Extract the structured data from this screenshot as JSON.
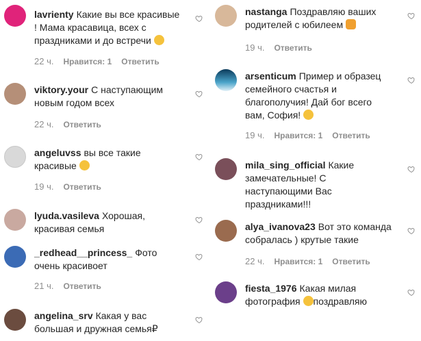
{
  "left": [
    {
      "user": "lavrienty",
      "text": "Какие вы все красивые ! Мама красавица, всех с праздниками и до встречи",
      "emoji": "😘",
      "time": "22 ч.",
      "likes": "Нравится: 1",
      "reply": "Ответить",
      "avatar": "#e0237a"
    },
    {
      "user": "viktory.your",
      "text": "С наступающим новым годом всех",
      "emoji": "",
      "time": "22 ч.",
      "likes": "",
      "reply": "Ответить",
      "avatar": "#b58f78"
    },
    {
      "user": "angeluvss",
      "text": "вы все такие красивые",
      "emoji": "😍",
      "time": "19 ч.",
      "likes": "",
      "reply": "Ответить",
      "avatar": "#d9d9d9"
    },
    {
      "user": "lyuda.vasileva",
      "text": "Хорошая, красивая семья",
      "emoji": "",
      "time": "",
      "likes": "",
      "reply": "",
      "avatar": "#c9a9a0"
    },
    {
      "user": "_redhead__princess_",
      "text": "Фото очень красивоет",
      "emoji": "",
      "time": "21 ч.",
      "likes": "",
      "reply": "Ответить",
      "avatar": "#3b6bb5"
    },
    {
      "user": "angelina_srv",
      "text": "Какая у вас большая и дружная семья₽",
      "emoji": "",
      "time": "",
      "likes": "",
      "reply": "",
      "avatar": "#6b4c3f"
    }
  ],
  "right": [
    {
      "user": "nastanga",
      "text": "Поздравляю ваших родителей с юбилеем",
      "emoji": "😼",
      "time": "19 ч.",
      "likes": "",
      "reply": "Ответить",
      "avatar": "#d8b89a"
    },
    {
      "user": "arsenticum",
      "text": "Пример и образец семейного счастья и благополучия! Дай бог всего вам, София!",
      "emoji": "🤗",
      "time": "19 ч.",
      "likes": "Нравится: 1",
      "reply": "Ответить",
      "avatar": "#4aa3c9"
    },
    {
      "user": "mila_sing_official",
      "text": "Какие замечательные! С наступающими Вас праздниками!!!",
      "emoji": "",
      "time": "",
      "likes": "",
      "reply": "",
      "avatar": "#7a4f5a"
    },
    {
      "user": "alya_ivanova23",
      "text": "Вот это команда собралась ) крутые такие",
      "emoji": "",
      "time": "22 ч.",
      "likes": "Нравится: 1",
      "reply": "Ответить",
      "avatar": "#9a6b4f"
    },
    {
      "user": "fiesta_1976",
      "text": "Какая милая фотография",
      "emoji": "😊",
      "text2": "поздравляю",
      "time": "",
      "likes": "",
      "reply": "",
      "avatar": "#6b3f8a"
    }
  ]
}
